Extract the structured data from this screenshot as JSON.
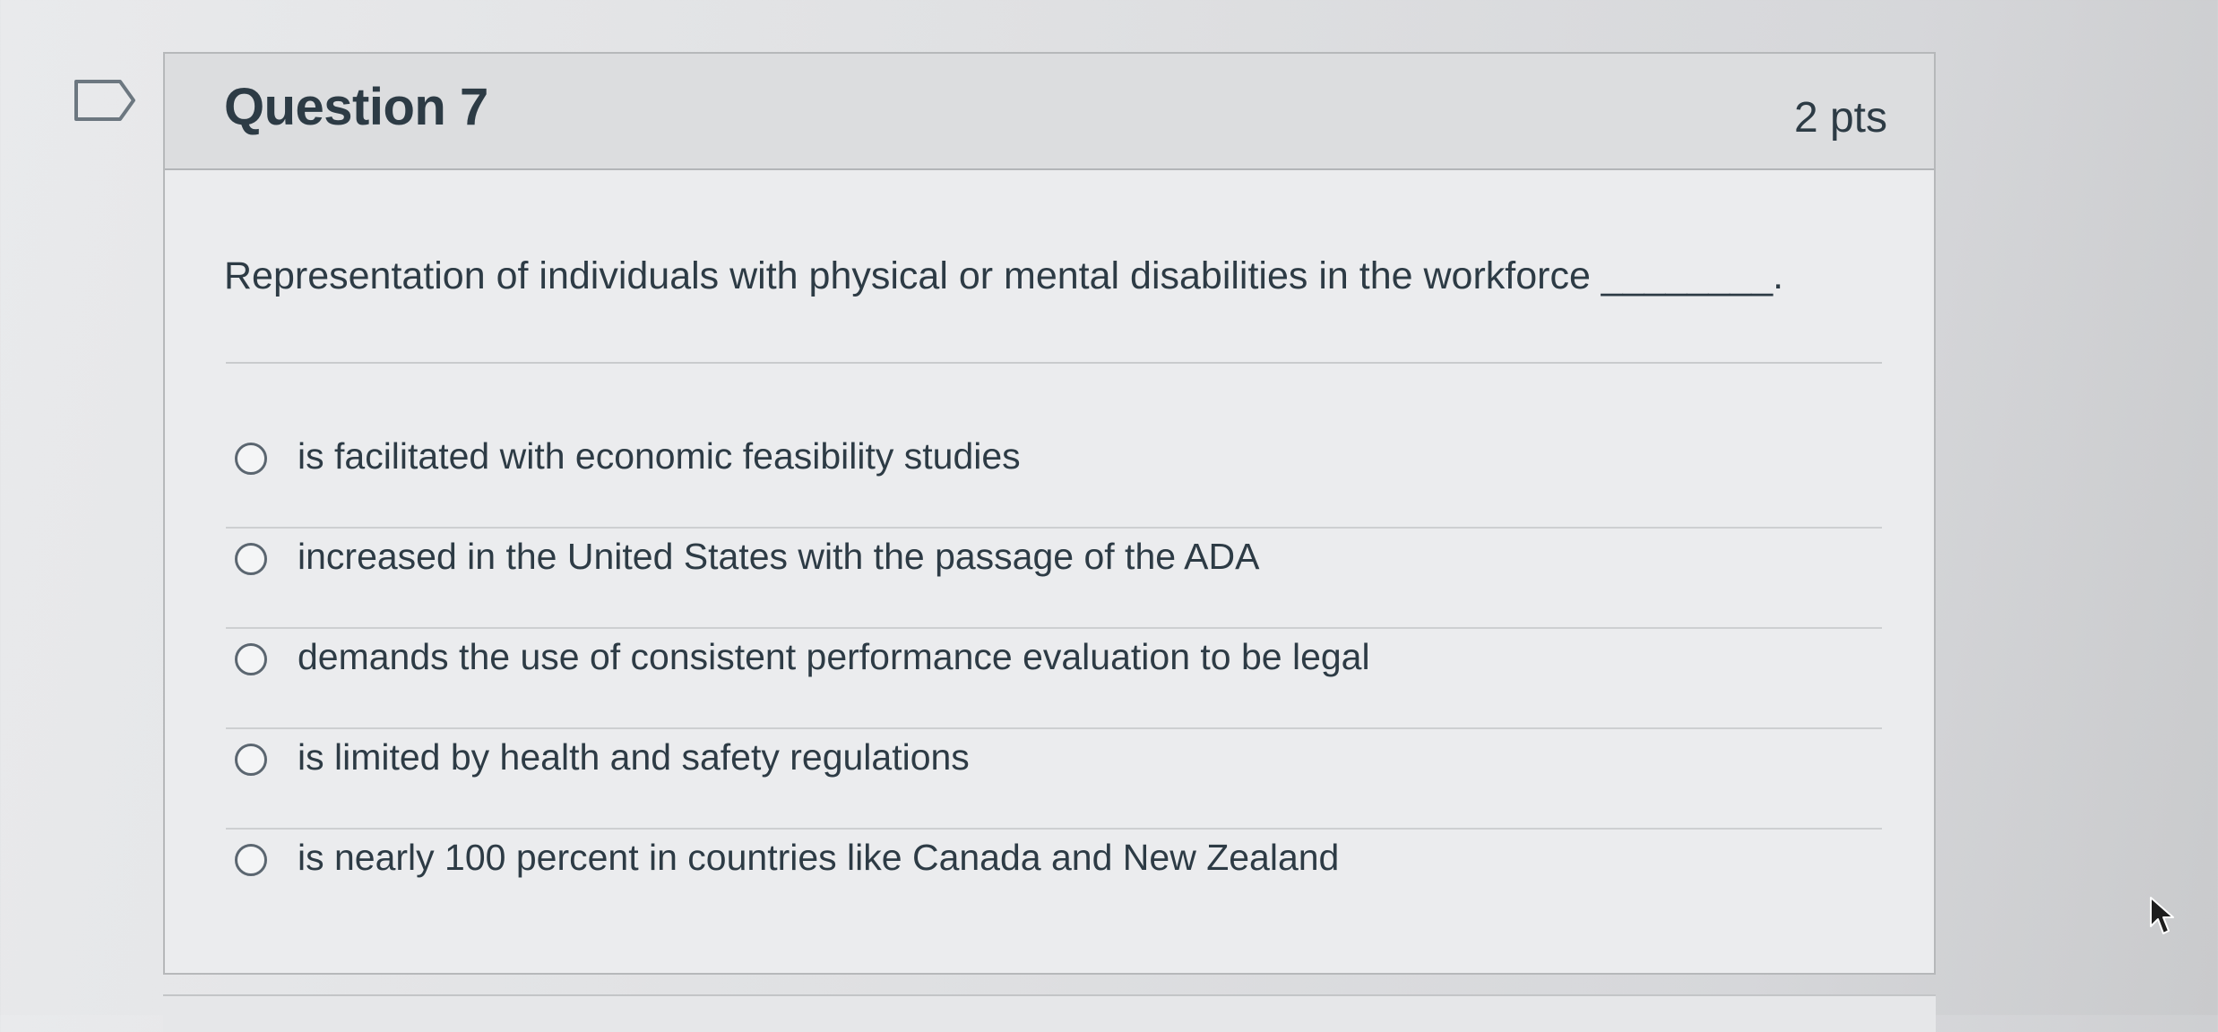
{
  "question": {
    "title": "Question 7",
    "points": "2 pts",
    "text": "Representation of individuals with physical or mental disabilities in the workforce ________."
  },
  "answers": [
    {
      "label": "is facilitated with economic feasibility studies",
      "selected": false
    },
    {
      "label": "increased in the United States with the passage of the ADA",
      "selected": false
    },
    {
      "label": "demands the use of consistent performance evaluation to be legal",
      "selected": false
    },
    {
      "label": "is limited by health and safety regulations",
      "selected": false
    },
    {
      "label": "is nearly 100 percent in countries like Canada and New Zealand",
      "selected": false
    }
  ],
  "icons": {
    "flag": "flag-question-icon",
    "cursor": "mouse-pointer-icon"
  },
  "colors": {
    "text": "#2d3b45",
    "header_background": "#dcdddf",
    "card_background": "#ebecee",
    "border": "#b6b8ba"
  }
}
